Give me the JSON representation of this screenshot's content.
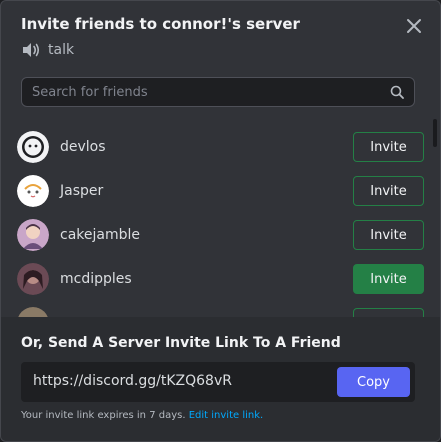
{
  "modal": {
    "title": "Invite friends to connor!'s server",
    "channel_name": "talk",
    "channel_icon": "speaker-icon",
    "close_icon": "close-icon"
  },
  "search": {
    "placeholder": "Search for friends",
    "value": "",
    "icon": "search-icon"
  },
  "friends": [
    {
      "name": "devlos",
      "button": "Invite",
      "avatar_color": "#f2f3f5"
    },
    {
      "name": "Jasper",
      "button": "Invite",
      "avatar_color": "#ffffff"
    },
    {
      "name": "cakejamble",
      "button": "Invite",
      "avatar_color": "#c9a6c8"
    },
    {
      "name": "mcdipples",
      "button": "Invite",
      "avatar_color": "#6b4a55",
      "hovered": true
    },
    {
      "name": "",
      "button": "",
      "avatar_color": "#8a7a66"
    }
  ],
  "footer": {
    "title": "Or, Send A Server Invite Link To A Friend",
    "invite_link": "https://discord.gg/tKZQ68vR",
    "copy_label": "Copy",
    "expiry_text": "Your invite link expires in 7 days.",
    "edit_link_label": "Edit invite link."
  },
  "colors": {
    "modal_bg": "#313338",
    "footer_bg": "#2b2d31",
    "invite_green": "#248046",
    "copy_blurple": "#5865f2",
    "link_blue": "#00a8fc"
  }
}
